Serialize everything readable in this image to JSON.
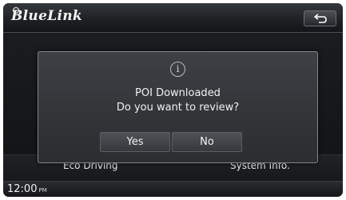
{
  "header": {
    "logo_text": "BlueLink",
    "back_icon": "return-arrow-icon"
  },
  "menu": {
    "left_label": "Eco Driving",
    "right_label": "System Info."
  },
  "dialog": {
    "icon": "info-icon",
    "icon_glyph": "i",
    "line1": "POI Downloaded",
    "line2": "Do you want to review?",
    "yes_label": "Yes",
    "no_label": "No"
  },
  "status": {
    "time": "12:00",
    "ampm": "PM"
  }
}
